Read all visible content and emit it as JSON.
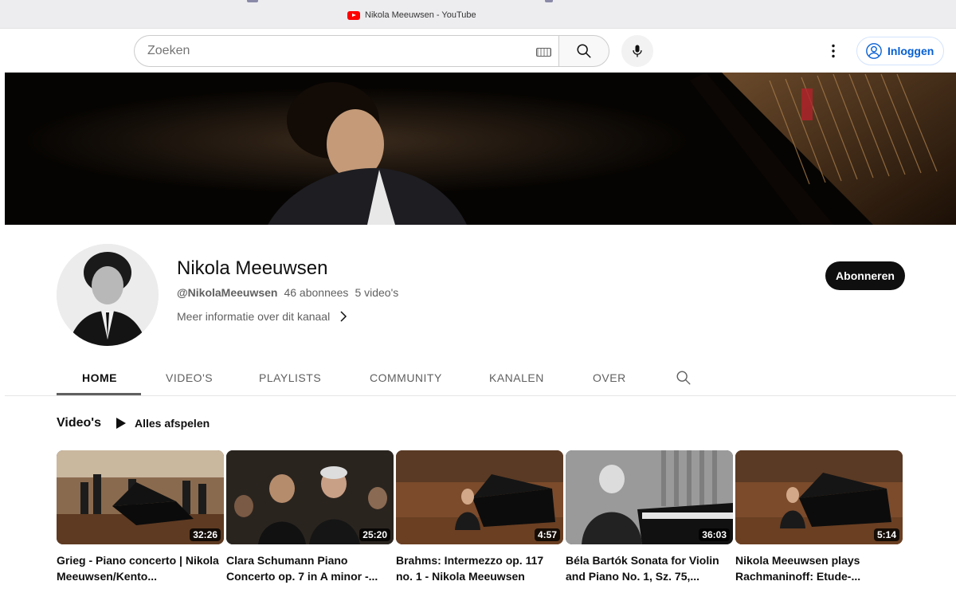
{
  "browser": {
    "tab_title": "Nikola Meeuwsen - YouTube"
  },
  "masthead": {
    "search_placeholder": "Zoeken",
    "signin_label": "Inloggen"
  },
  "channel": {
    "name": "Nikola Meeuwsen",
    "handle": "@NikolaMeeuwsen",
    "subscribers": "46 abonnees",
    "videos_count": "5 video's",
    "more_info": "Meer informatie over dit kanaal",
    "subscribe_label": "Abonneren"
  },
  "tabs": [
    {
      "label": "HOME",
      "active": true
    },
    {
      "label": "VIDEO'S",
      "active": false
    },
    {
      "label": "PLAYLISTS",
      "active": false
    },
    {
      "label": "COMMUNITY",
      "active": false
    },
    {
      "label": "KANALEN",
      "active": false
    },
    {
      "label": "OVER",
      "active": false
    }
  ],
  "section": {
    "title": "Video's",
    "play_all": "Alles afspelen"
  },
  "videos": [
    {
      "title": "Grieg - Piano concerto | Nikola Meeuwsen/Kento...",
      "duration": "32:26"
    },
    {
      "title": "Clara Schumann Piano Concerto op. 7 in A minor -...",
      "duration": "25:20"
    },
    {
      "title": "Brahms: Intermezzo op. 117 no. 1 - Nikola Meeuwsen",
      "duration": "4:57"
    },
    {
      "title": "Béla Bartók Sonata for Violin and Piano No. 1, Sz. 75,...",
      "duration": "36:03"
    },
    {
      "title": "Nikola Meeuwsen plays Rachmaninoff: Etude-...",
      "duration": "5:14"
    }
  ],
  "icons": {
    "favicon": "youtube-favicon",
    "keyboard": "keyboard-icon",
    "search": "search-icon",
    "mic": "microphone-icon",
    "more": "more-vertical-icon",
    "account": "account-circle-icon",
    "chevron": "chevron-right-icon",
    "play": "play-icon"
  },
  "colors": {
    "accent": "#065fd4",
    "subscribe": "#0f0f0f",
    "brand": "#ff0000"
  }
}
